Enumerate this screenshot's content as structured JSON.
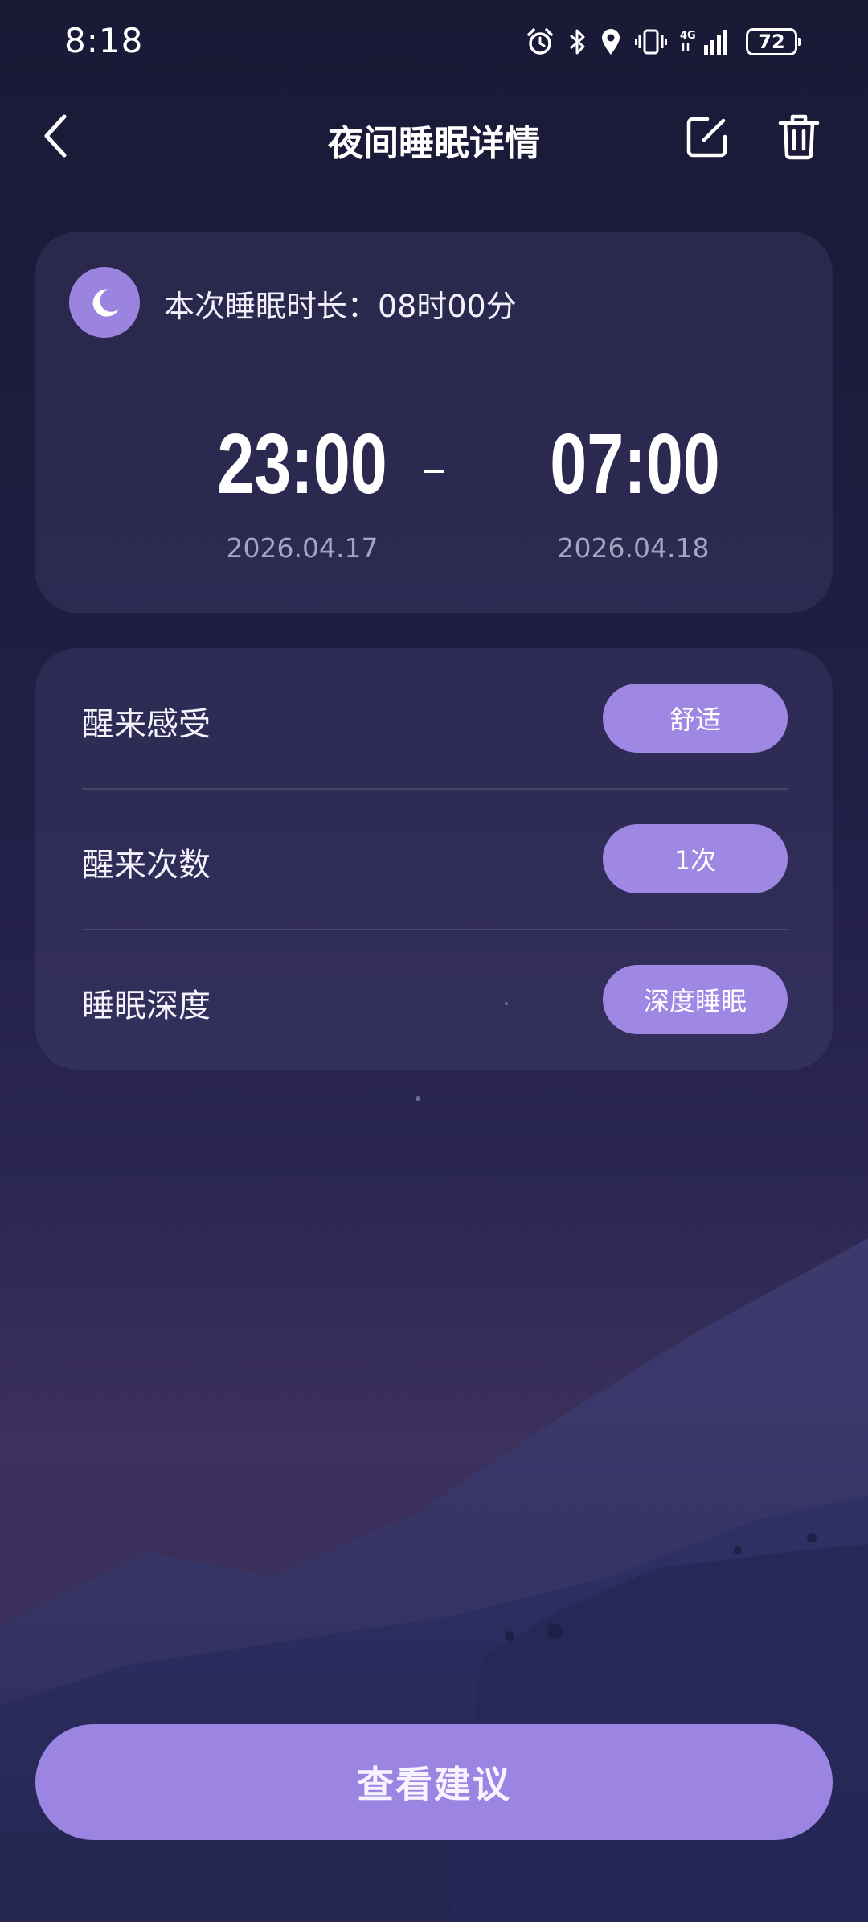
{
  "status_bar": {
    "time": "8:18",
    "battery": "72",
    "network": "4G",
    "icons": [
      "alarm-icon",
      "bluetooth-icon",
      "location-icon",
      "vibrate-icon",
      "signal-icon",
      "battery-icon"
    ]
  },
  "header": {
    "title": "夜间睡眠详情",
    "icons": [
      "back-icon",
      "edit-icon",
      "delete-icon"
    ]
  },
  "duration_card": {
    "label": "本次睡眠时长：08时00分",
    "start_time": "23:00",
    "end_time": "07:00",
    "start_date": "2026.04.17",
    "end_date": "2026.04.18",
    "icon": "moon-icon"
  },
  "info_card": {
    "rows": [
      {
        "label": "醒来感受",
        "value": "舒适"
      },
      {
        "label": "醒来次数",
        "value": "1次"
      },
      {
        "label": "睡眠深度",
        "value": "深度睡眠"
      }
    ]
  },
  "bottom": {
    "button_label": "查看建议"
  },
  "colors": {
    "accent": "#9b84e2",
    "background": "#1d1c3f"
  }
}
